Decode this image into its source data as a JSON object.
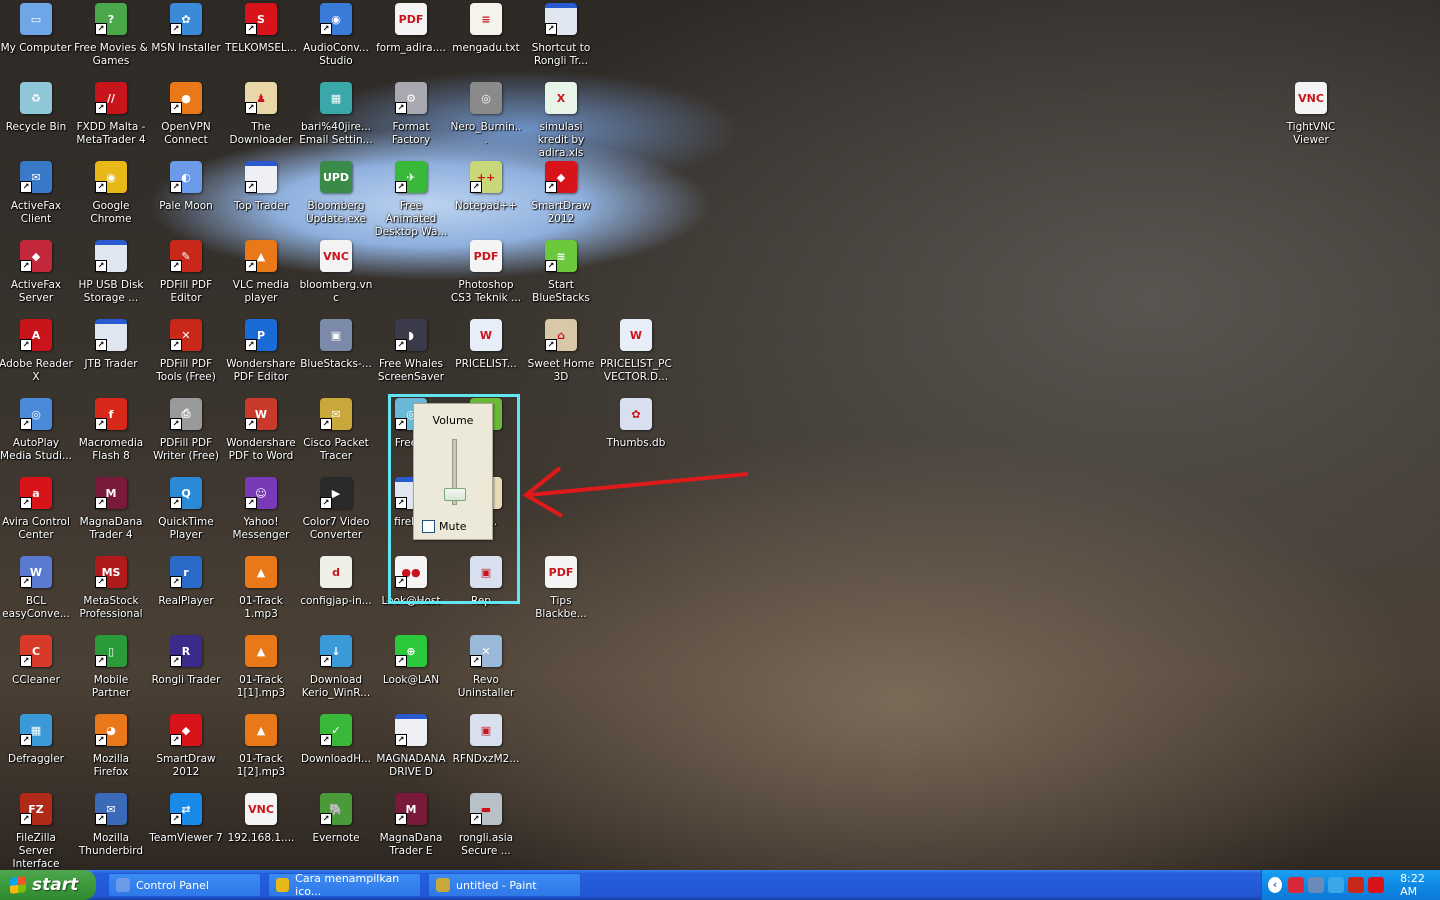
{
  "desktop": {
    "columns": [
      [
        {
          "label": "My Computer",
          "icon": "computer-icon",
          "color": "#6fa6e8",
          "glyph": "▭",
          "shortcut": false
        },
        {
          "label": "Recycle Bin",
          "icon": "recycle-bin-icon",
          "color": "#8fc6d8",
          "glyph": "♻",
          "shortcut": false
        },
        {
          "label": "ActiveFax Client",
          "icon": "activefax-icon",
          "color": "#3a78c8",
          "glyph": "✉",
          "shortcut": true
        },
        {
          "label": "ActiveFax Server",
          "icon": "activefax-server-icon",
          "color": "#c2283a",
          "glyph": "◆",
          "shortcut": true
        },
        {
          "label": "Adobe Reader X",
          "icon": "adobe-reader-icon",
          "color": "#c8141a",
          "glyph": "A",
          "shortcut": true
        },
        {
          "label": "AutoPlay Media Studi...",
          "icon": "autoplay-icon",
          "color": "#4a8ad8",
          "glyph": "◎",
          "shortcut": true
        },
        {
          "label": "Avira Control Center",
          "icon": "avira-icon",
          "color": "#d8141a",
          "glyph": "a",
          "shortcut": true
        },
        {
          "label": "BCL easyConve...",
          "icon": "bcl-icon",
          "color": "#5a7ad0",
          "glyph": "W",
          "shortcut": true
        },
        {
          "label": "CCleaner",
          "icon": "ccleaner-icon",
          "color": "#d83a2a",
          "glyph": "C",
          "shortcut": true
        },
        {
          "label": "Defraggler",
          "icon": "defraggler-icon",
          "color": "#3a9ad8",
          "glyph": "▦",
          "shortcut": true
        },
        {
          "label": "FileZilla Server Interface",
          "icon": "filezilla-icon",
          "color": "#b02a1a",
          "glyph": "FZ",
          "shortcut": true
        }
      ],
      [
        {
          "label": "Free Movies & Games",
          "icon": "gift-icon",
          "color": "#4aa84a",
          "glyph": "?",
          "shortcut": true
        },
        {
          "label": "FXDD Malta - MetaTrader 4",
          "icon": "metatrader-icon",
          "color": "#c8141a",
          "glyph": "//",
          "shortcut": true
        },
        {
          "label": "Google Chrome",
          "icon": "chrome-icon",
          "color": "#e8b818",
          "glyph": "◉",
          "shortcut": true
        },
        {
          "label": "HP USB Disk Storage ...",
          "icon": "window-icon",
          "color": "#dfe6f0",
          "glyph": "",
          "shortcut": true
        },
        {
          "label": "JTB Trader",
          "icon": "window-icon",
          "color": "#dfe6f0",
          "glyph": "",
          "shortcut": true
        },
        {
          "label": "Macromedia Flash 8",
          "icon": "flash-icon",
          "color": "#d8281a",
          "glyph": "f",
          "shortcut": true
        },
        {
          "label": "MagnaDana Trader 4",
          "icon": "magnadana-icon",
          "color": "#7a1a3a",
          "glyph": "M",
          "shortcut": true
        },
        {
          "label": "MetaStock Professional",
          "icon": "metastock-icon",
          "color": "#b01a1a",
          "glyph": "MS",
          "shortcut": true
        },
        {
          "label": "Mobile Partner",
          "icon": "mobile-partner-icon",
          "color": "#2a9a3a",
          "glyph": "▯",
          "shortcut": true
        },
        {
          "label": "Mozilla Firefox",
          "icon": "firefox-icon",
          "color": "#e8781a",
          "glyph": "◕",
          "shortcut": true
        },
        {
          "label": "Mozilla Thunderbird",
          "icon": "thunderbird-icon",
          "color": "#3a6ab8",
          "glyph": "✉",
          "shortcut": true
        }
      ],
      [
        {
          "label": "MSN Installer",
          "icon": "msn-icon",
          "color": "#3a8ad8",
          "glyph": "✿",
          "shortcut": true
        },
        {
          "label": "OpenVPN Connect",
          "icon": "openvpn-icon",
          "color": "#e87818",
          "glyph": "●",
          "shortcut": true
        },
        {
          "label": "Pale Moon",
          "icon": "pale-moon-icon",
          "color": "#6a9ae8",
          "glyph": "◐",
          "shortcut": true
        },
        {
          "label": "PDFill PDF Editor",
          "icon": "pdfill-icon",
          "color": "#c8281a",
          "glyph": "✎",
          "shortcut": true
        },
        {
          "label": "PDFill PDF Tools (Free)",
          "icon": "pdfill-tools-icon",
          "color": "#c8281a",
          "glyph": "✕",
          "shortcut": true
        },
        {
          "label": "PDFill PDF Writer (Free)",
          "icon": "pdfill-writer-icon",
          "color": "#9a9a9a",
          "glyph": "⎙",
          "shortcut": true
        },
        {
          "label": "QuickTime Player",
          "icon": "quicktime-icon",
          "color": "#2a8ad8",
          "glyph": "Q",
          "shortcut": true
        },
        {
          "label": "RealPlayer",
          "icon": "realplayer-icon",
          "color": "#2a6ac8",
          "glyph": "r",
          "shortcut": true
        },
        {
          "label": "Rongli Trader",
          "icon": "rongli-icon",
          "color": "#3a2a8a",
          "glyph": "R",
          "shortcut": true
        },
        {
          "label": "SmartDraw 2012",
          "icon": "smartdraw-icon",
          "color": "#d8141a",
          "glyph": "◆",
          "shortcut": true
        },
        {
          "label": "TeamViewer 7",
          "icon": "teamviewer-icon",
          "color": "#1a8ae8",
          "glyph": "⇄",
          "shortcut": true
        }
      ],
      [
        {
          "label": "TELKOMSEL...",
          "icon": "telkomsel-icon",
          "color": "#d8141a",
          "glyph": "S",
          "shortcut": true
        },
        {
          "label": "The Downloader",
          "icon": "downloader-icon",
          "color": "#e8d8a8",
          "glyph": "♟",
          "shortcut": true
        },
        {
          "label": "Top Trader",
          "icon": "document-icon",
          "color": "#eef0f6",
          "glyph": "",
          "shortcut": true
        },
        {
          "label": "VLC media player",
          "icon": "vlc-icon",
          "color": "#e87818",
          "glyph": "▲",
          "shortcut": true
        },
        {
          "label": "Wondershare PDF Editor",
          "icon": "wondershare-icon",
          "color": "#1a6ad8",
          "glyph": "P",
          "shortcut": true
        },
        {
          "label": "Wondershare PDF to Word",
          "icon": "pdf-to-word-icon",
          "color": "#c83a2a",
          "glyph": "W",
          "shortcut": true
        },
        {
          "label": "Yahoo! Messenger",
          "icon": "yahoo-icon",
          "color": "#7a3ab8",
          "glyph": "☺",
          "shortcut": true
        },
        {
          "label": "01-Track 1.mp3",
          "icon": "vlc-icon",
          "color": "#e87818",
          "glyph": "▲",
          "shortcut": false
        },
        {
          "label": "01-Track 1[1].mp3",
          "icon": "vlc-icon",
          "color": "#e87818",
          "glyph": "▲",
          "shortcut": false
        },
        {
          "label": "01-Track 1[2].mp3",
          "icon": "vlc-icon",
          "color": "#e87818",
          "glyph": "▲",
          "shortcut": false
        },
        {
          "label": "192.168.1....",
          "icon": "vnc-icon",
          "color": "#f4f4f4",
          "glyph": "VNC",
          "shortcut": false
        }
      ],
      [
        {
          "label": "AudioConv... Studio",
          "icon": "audioconverter-icon",
          "color": "#3a7ad8",
          "glyph": "◉",
          "shortcut": true
        },
        {
          "label": "bari%40jire... Email Settin...",
          "icon": "registry-icon",
          "color": "#3aa8a8",
          "glyph": "▦",
          "shortcut": false
        },
        {
          "label": "Bloomberg Update.exe",
          "icon": "bloomberg-update-icon",
          "color": "#3a8a4a",
          "glyph": "UPD",
          "shortcut": false
        },
        {
          "label": "bloomberg.vnc",
          "icon": "vnc-icon",
          "color": "#f4f4f4",
          "glyph": "VNC",
          "shortcut": false
        },
        {
          "label": "BlueStacks-...",
          "icon": "installer-icon",
          "color": "#7a8aa8",
          "glyph": "▣",
          "shortcut": false
        },
        {
          "label": "Cisco Packet Tracer",
          "icon": "cisco-icon",
          "color": "#c8a83a",
          "glyph": "✉",
          "shortcut": true
        },
        {
          "label": "Color7 Video Converter",
          "icon": "video-icon",
          "color": "#2a2a2a",
          "glyph": "▶",
          "shortcut": true
        },
        {
          "label": "configjap-in...",
          "icon": "config-file-icon",
          "color": "#eef0e8",
          "glyph": "d",
          "shortcut": false
        },
        {
          "label": "Download Kerio_WinR...",
          "icon": "download-icon",
          "color": "#3a9ad8",
          "glyph": "↓",
          "shortcut": true
        },
        {
          "label": "DownloadH...",
          "icon": "downloadhelper-icon",
          "color": "#3ab83a",
          "glyph": "✓",
          "shortcut": true
        },
        {
          "label": "Evernote",
          "icon": "evernote-icon",
          "color": "#4a9a3a",
          "glyph": "🐘",
          "shortcut": true
        }
      ],
      [
        {
          "label": "form_adira....",
          "icon": "pdf-icon",
          "color": "#f4f4f4",
          "glyph": "PDF",
          "shortcut": false
        },
        {
          "label": "Format Factory",
          "icon": "format-factory-icon",
          "color": "#a8a8b0",
          "glyph": "⚙",
          "shortcut": true
        },
        {
          "label": "Free Animated Desktop Wa...",
          "icon": "parrot-icon",
          "color": "#3ab83a",
          "glyph": "✈",
          "shortcut": true
        },
        null,
        {
          "label": "Free Whales ScreenSaver",
          "icon": "whale-icon",
          "color": "#3a3a4a",
          "glyph": "◗",
          "shortcut": true
        },
        {
          "label": "Free...",
          "icon": "cd-icon",
          "color": "#6ab8d8",
          "glyph": "◎",
          "shortcut": true
        },
        {
          "label": "fireh...",
          "icon": "window-icon",
          "color": "#dfe6f0",
          "glyph": "",
          "shortcut": true
        },
        {
          "label": "Look@Host",
          "icon": "eyes-icon",
          "color": "#f4f4f4",
          "glyph": "●●",
          "shortcut": true
        },
        {
          "label": "Look@LAN",
          "icon": "look-at-lan-icon",
          "color": "#2ac83a",
          "glyph": "⊕",
          "shortcut": true
        },
        {
          "label": "MAGNADANA DRIVE D",
          "icon": "document-icon",
          "color": "#eef0f6",
          "glyph": "",
          "shortcut": true
        },
        {
          "label": "MagnaDana Trader E",
          "icon": "magnadana-icon",
          "color": "#7a1a3a",
          "glyph": "M",
          "shortcut": true
        }
      ],
      [
        {
          "label": "mengadu.txt",
          "icon": "text-file-icon",
          "color": "#f4f4ec",
          "glyph": "≡",
          "shortcut": false
        },
        {
          "label": "Nero_Burnin...",
          "icon": "nero-icon",
          "color": "#8a8a8a",
          "glyph": "◎",
          "shortcut": false
        },
        {
          "label": "Notepad++",
          "icon": "notepadpp-icon",
          "color": "#c8d878",
          "glyph": "++",
          "shortcut": true
        },
        {
          "label": "Photoshop CS3 Teknik ...",
          "icon": "pdf-icon",
          "color": "#f4f4f4",
          "glyph": "PDF",
          "shortcut": false
        },
        {
          "label": "PRICELIST...",
          "icon": "word-doc-icon",
          "color": "#e8eef8",
          "glyph": "W",
          "shortcut": false
        },
        {
          "label": "e",
          "icon": "app-icon",
          "color": "#6ab83a",
          "glyph": "",
          "shortcut": false
        },
        {
          "label": "isto.",
          "icon": "app-icon",
          "color": "#e8d8b8",
          "glyph": "",
          "shortcut": false
        },
        {
          "label": "Rep...",
          "icon": "image-file-icon",
          "color": "#d8e0f0",
          "glyph": "▣",
          "shortcut": false
        },
        {
          "label": "Revo Uninstaller",
          "icon": "revo-icon",
          "color": "#9ab8d8",
          "glyph": "✕",
          "shortcut": true
        },
        {
          "label": "RFNDxzM2...",
          "icon": "image-file-icon",
          "color": "#d8e0f0",
          "glyph": "▣",
          "shortcut": false
        },
        {
          "label": "rongli.asia Secure ...",
          "icon": "network-drive-icon",
          "color": "#b8c0c8",
          "glyph": "▬",
          "shortcut": true
        }
      ],
      [
        {
          "label": "Shortcut to Rongli Tr...",
          "icon": "window-icon",
          "color": "#dfe6f0",
          "glyph": "",
          "shortcut": true
        },
        {
          "label": "simulasi kredit by adira.xls",
          "icon": "excel-icon",
          "color": "#e8f4e8",
          "glyph": "X",
          "shortcut": false
        },
        {
          "label": "SmartDraw 2012",
          "icon": "smartdraw-icon",
          "color": "#d8141a",
          "glyph": "◆",
          "shortcut": true
        },
        {
          "label": "Start BlueStacks",
          "icon": "bluestacks-icon",
          "color": "#6ac83a",
          "glyph": "≋",
          "shortcut": true
        },
        {
          "label": "Sweet Home 3D",
          "icon": "sweet-home-icon",
          "color": "#d8c8a8",
          "glyph": "⌂",
          "shortcut": true
        },
        null,
        null,
        {
          "label": "Tips Blackbe...",
          "icon": "pdf-icon",
          "color": "#f4f4f4",
          "glyph": "PDF",
          "shortcut": false
        }
      ],
      [
        null,
        null,
        null,
        null,
        {
          "label": "PRICELIST_PC VECTOR.D...",
          "icon": "word-doc-icon",
          "color": "#e8eef8",
          "glyph": "W",
          "shortcut": false
        },
        {
          "label": "Thumbs.db",
          "icon": "thumbs-db-icon",
          "color": "#d8e0f0",
          "glyph": "✿",
          "shortcut": false
        }
      ]
    ],
    "right_icons": [
      {
        "label": "TightVNC Viewer",
        "icon": "vnc-icon",
        "color": "#f4f4f4",
        "glyph": "VNC",
        "shortcut": false
      }
    ]
  },
  "volume_popup": {
    "title": "Volume",
    "mute_label": "Mute",
    "muted": false,
    "level_percent": 15
  },
  "annotation": {
    "highlight_color": "#5fe6f0",
    "arrow_color": "#e01a1a"
  },
  "taskbar": {
    "start_label": "start",
    "tasks": [
      {
        "label": "Control Panel",
        "icon": "control-panel-icon",
        "color": "#6a9ae8"
      },
      {
        "label": "Cara menampilkan ico...",
        "icon": "chrome-icon",
        "color": "#e8b818"
      },
      {
        "label": "untitled - Paint",
        "icon": "paint-icon",
        "color": "#c8a83a"
      }
    ],
    "tray_icons": [
      {
        "icon": "shield-alert-icon",
        "color": "#d8283a"
      },
      {
        "icon": "network-disconnected-icon",
        "color": "#6a8ab8"
      },
      {
        "icon": "network-icon",
        "color": "#3aa8e8"
      },
      {
        "icon": "metatrader-tray-icon",
        "color": "#c8281a"
      },
      {
        "icon": "avira-tray-icon",
        "color": "#d8141a"
      }
    ],
    "clock": "8:22 AM"
  }
}
